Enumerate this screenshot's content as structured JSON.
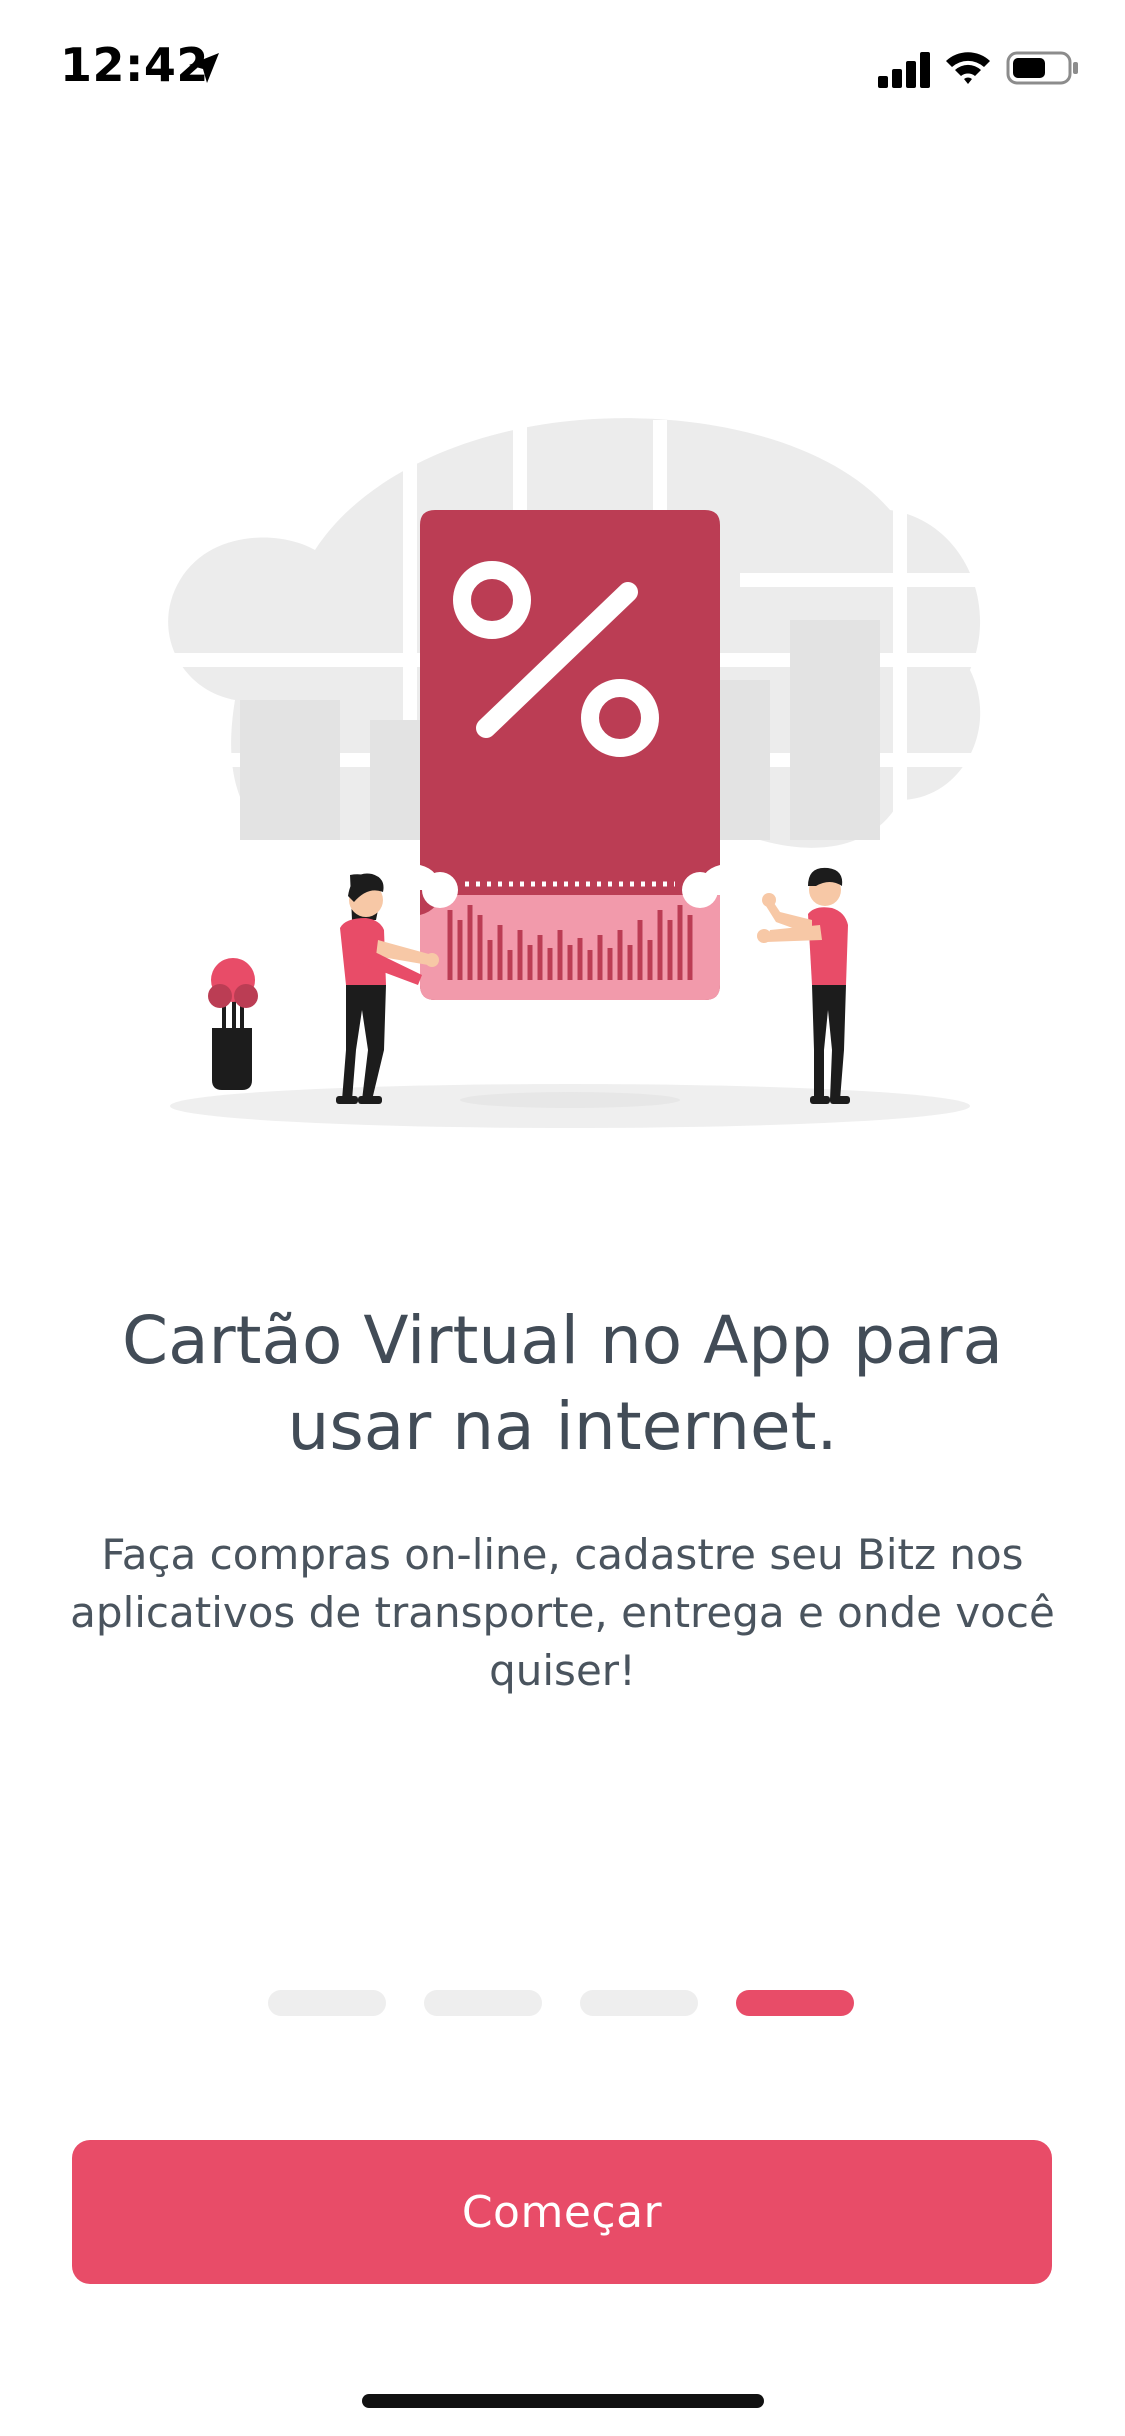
{
  "status_bar": {
    "time": "12:42",
    "icons": [
      "location-arrow-icon",
      "cellular-signal-icon",
      "wifi-icon",
      "battery-icon"
    ]
  },
  "illustration": {
    "description_icon": "virtual-card-percent-ticket-icon",
    "colors": {
      "ticket_dark": "#bb3d54",
      "ticket_light": "#f29aab",
      "accent": "#e84c68",
      "bg": "#ececec"
    }
  },
  "onboarding": {
    "title": "Cartão Virtual no App para usar na internet.",
    "body": "Faça compras on-line, cadastre seu Bitz nos aplicativos de transporte, entrega e onde você quiser!",
    "pager": {
      "total": 4,
      "current": 4
    }
  },
  "actions": {
    "start_label": "Começar"
  },
  "colors": {
    "accent": "#e84c68",
    "text": "#424c57"
  }
}
